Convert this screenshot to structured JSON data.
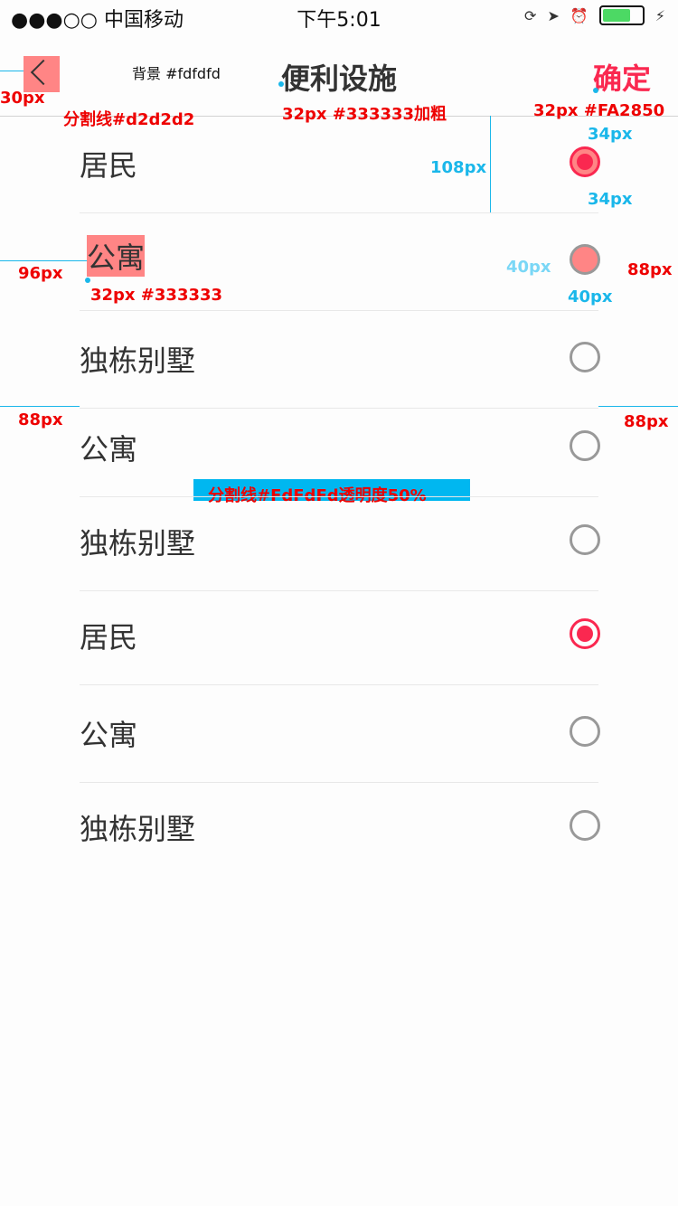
{
  "status_bar": {
    "carrier": "●●●○○ 中国移动",
    "time": "下午5:01"
  },
  "nav": {
    "title": "便利设施",
    "confirm": "确定"
  },
  "annotations": {
    "a1": "30px",
    "a2": "背景  #fdfdfd",
    "a3": "分割线#d2d2d2",
    "a4": "32px #333333加粗",
    "a5": "32px #FA2850",
    "a6": "34px",
    "a7": "108px",
    "a8": "34px",
    "a9": "96px",
    "a10": "32px #333333",
    "a11": "40px",
    "a12": "40px",
    "a13": "88px",
    "a14": "88px",
    "a15": "88px",
    "a16": "分割线#FdFdFd透明度50%"
  },
  "list": [
    {
      "label": "居民",
      "selected": true
    },
    {
      "label": "公寓",
      "selected": false
    },
    {
      "label": "独栋别墅",
      "selected": false
    },
    {
      "label": "公寓",
      "selected": false
    },
    {
      "label": "独栋别墅",
      "selected": false
    },
    {
      "label": "居民",
      "selected": true
    },
    {
      "label": "公寓",
      "selected": false
    },
    {
      "label": "独栋别墅",
      "selected": false
    }
  ],
  "colors": {
    "background": "#fdfdfd",
    "accent": "#FA2850",
    "text": "#333333",
    "divider": "#d2d2d2"
  }
}
